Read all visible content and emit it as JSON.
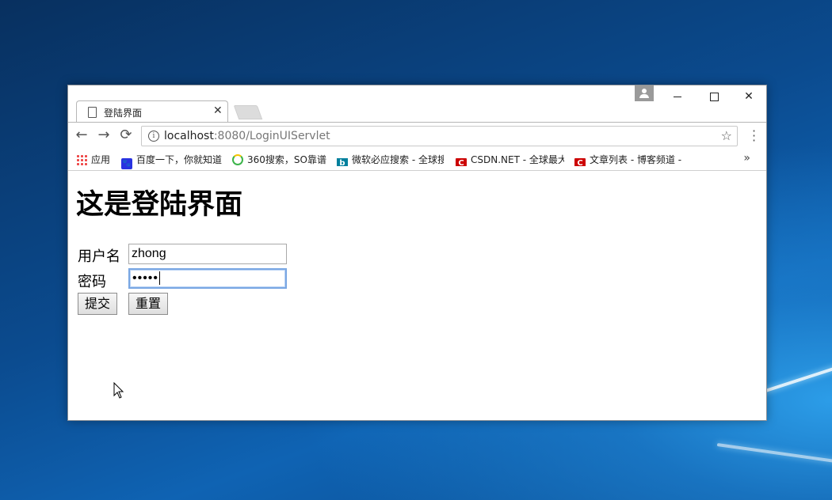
{
  "browser": {
    "tab_title": "登陆界面",
    "tab_close": "✕",
    "address": {
      "host": "localhost",
      "path": ":8080/LoginUIServlet"
    },
    "nav": {
      "back": "←",
      "forward": "→",
      "reload": "⟳"
    },
    "window_controls": {
      "close": "✕"
    }
  },
  "bookmarks": [
    {
      "icon": "apps-icon",
      "label": "应用"
    },
    {
      "icon": "baidu-icon",
      "label": "百度一下，你就知道"
    },
    {
      "icon": "360-icon",
      "label": "360搜索，SO靠谱"
    },
    {
      "icon": "bing-icon",
      "label": "微软必应搜索 - 全球搜"
    },
    {
      "icon": "csdn-icon",
      "label": "CSDN.NET - 全球最大"
    },
    {
      "icon": "csdn-icon",
      "label": "文章列表 - 博客频道 -"
    }
  ],
  "bookmarks_more": "»",
  "page": {
    "heading": "这是登陆界面",
    "username_label": "用户名",
    "username_value": "zhong",
    "password_label": "密码",
    "password_value": "•••••",
    "submit_label": "提交",
    "reset_label": "重置"
  }
}
